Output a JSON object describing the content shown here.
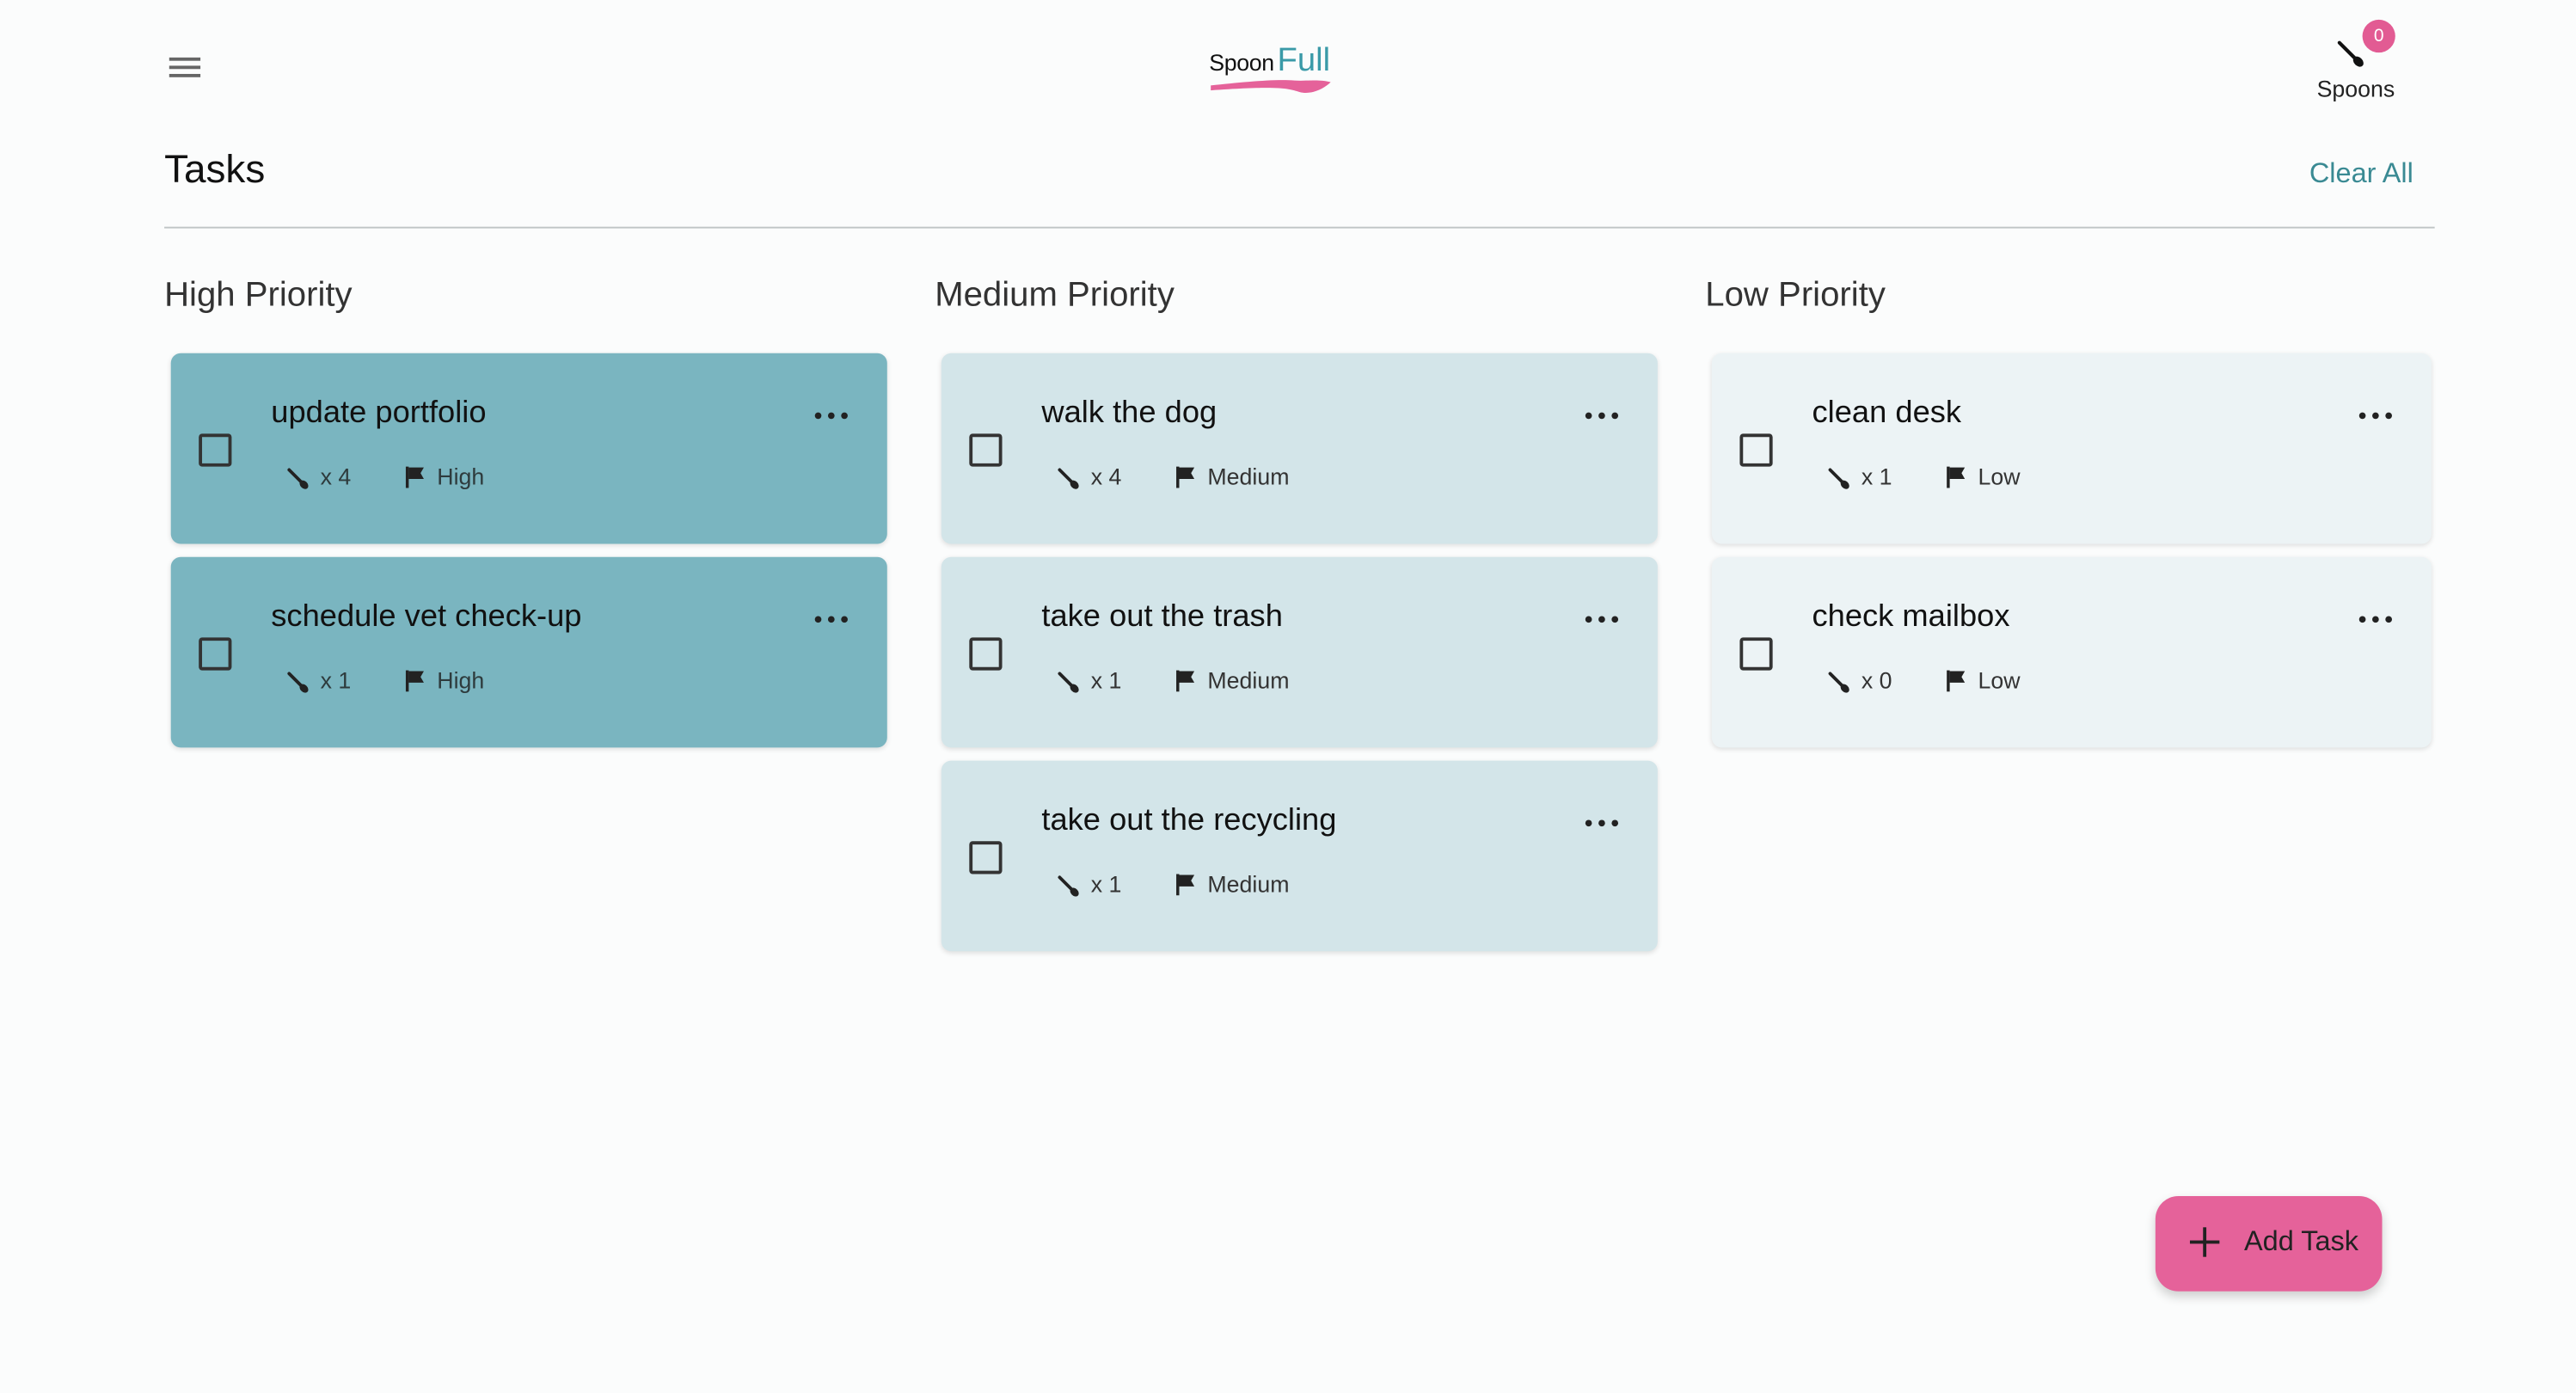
{
  "header": {
    "logo": {
      "part1": "Spoon",
      "part2": "Full"
    },
    "spoons": {
      "count": "0",
      "label": "Spoons"
    }
  },
  "page": {
    "title": "Tasks",
    "clear_all": "Clear All"
  },
  "columns": {
    "high": {
      "title": "High Priority",
      "tasks": [
        {
          "name": "update portfolio",
          "spoons": "x 4",
          "priority": "High"
        },
        {
          "name": "schedule vet check-up",
          "spoons": "x 1",
          "priority": "High"
        }
      ]
    },
    "medium": {
      "title": "Medium Priority",
      "tasks": [
        {
          "name": "walk the dog",
          "spoons": "x 4",
          "priority": "Medium"
        },
        {
          "name": "take out the trash",
          "spoons": "x 1",
          "priority": "Medium"
        },
        {
          "name": "take out the recycling",
          "spoons": "x 1",
          "priority": "Medium"
        }
      ]
    },
    "low": {
      "title": "Low Priority",
      "tasks": [
        {
          "name": "clean desk",
          "spoons": "x 1",
          "priority": "Low"
        },
        {
          "name": "check mailbox",
          "spoons": "x 0",
          "priority": "Low"
        }
      ]
    }
  },
  "fab": {
    "label": "Add Task"
  },
  "colors": {
    "accent_pink": "#e5629a",
    "accent_teal": "#3a9aa8",
    "high_card": "#7ab5c0",
    "medium_card": "#d3e5e9",
    "low_card": "#ecf3f5"
  },
  "icons": {
    "menu": "hamburger-icon",
    "spoon": "spoon-icon",
    "flag": "flag-icon",
    "more": "more-horizontal-icon",
    "add": "plus-icon"
  }
}
